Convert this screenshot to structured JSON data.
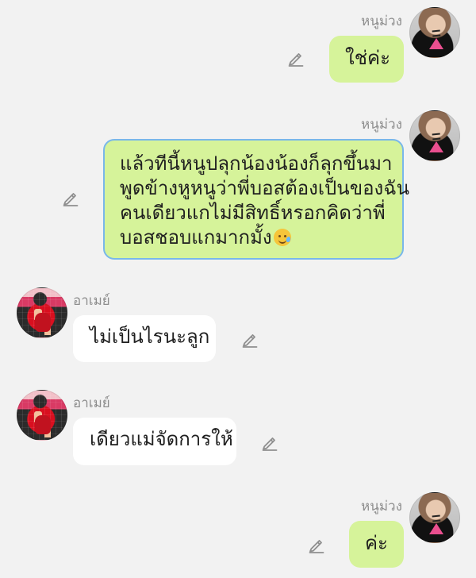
{
  "messages": [
    {
      "sender": "หนูม่วง",
      "text": "ใช่ค่ะ",
      "type": "self"
    },
    {
      "sender": "หนูม่วง",
      "lines": [
        "แล้วทีนี้หนูปลุกน้องน้องก็ลุกขึ้นมา",
        "พูดข้างหูหนูว่าพี่บอสต้องเป็นของฉัน",
        "คนเดียวแกไม่มีสิทธิ์หรอกคิดว่าพี่",
        "บอสชอบแกมากมั้ง"
      ],
      "type": "self",
      "emoji": "smiling-face-with-tear-emoji"
    },
    {
      "sender": "อาเมย์",
      "text": "ไม่เป็นไรนะลูก",
      "type": "other"
    },
    {
      "sender": "อาเมย์",
      "text": "เดียวแม่จัดการให้",
      "type": "other"
    },
    {
      "sender": "หนูม่วง",
      "text": "ค่ะ",
      "type": "self"
    }
  ],
  "icons": {
    "edit": "pencil-icon"
  },
  "colors": {
    "background": "#f2f2f2",
    "self_bubble": "#d6f39a",
    "other_bubble": "#ffffff",
    "selected_border": "#79b7ea",
    "muted_text": "#8d8d8d"
  }
}
